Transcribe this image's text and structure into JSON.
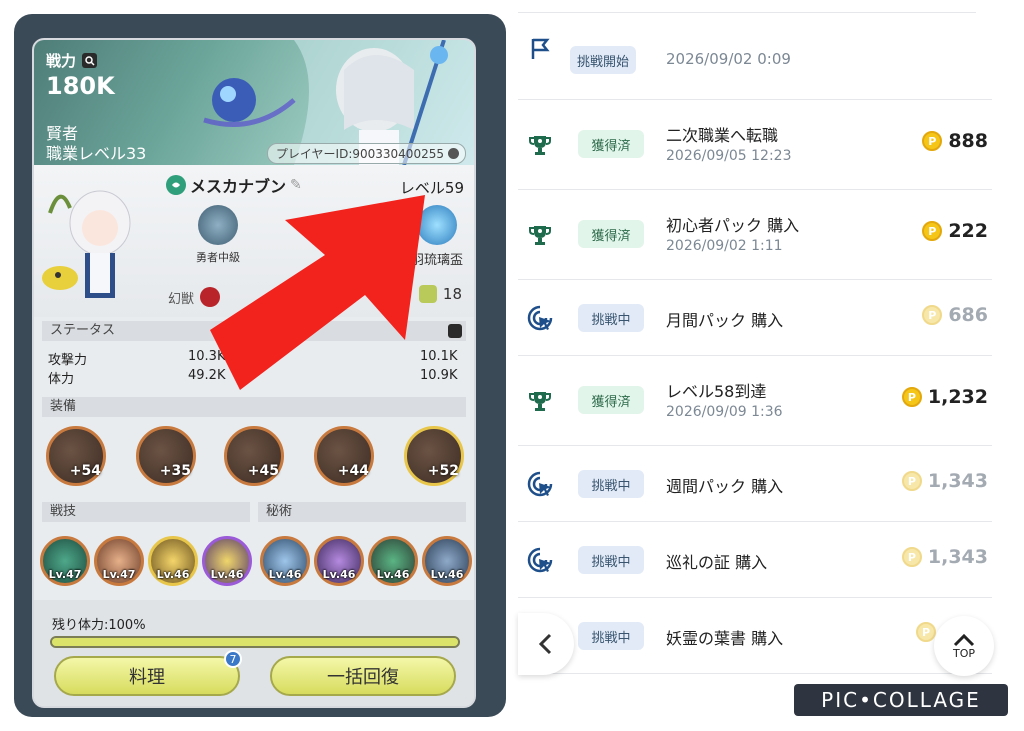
{
  "game": {
    "power_label": "戦力",
    "power_value": "180K",
    "class_name": "賢者",
    "class_level": "職業レベル33",
    "player_id": "プレイヤーID:900330400255",
    "char_name": "メスカナブン",
    "level": "レベル59",
    "badges": [
      {
        "label": "勇者中級"
      },
      {
        "label": "羽琉璃盃"
      }
    ],
    "gen_label": "幻獣",
    "likes": "18",
    "status_header": "ステータス",
    "stats": {
      "atk_label": "攻撃力",
      "atk_value": "10.3K",
      "hp_label": "体力",
      "hp_value": "49.2K",
      "right1": "10.1K",
      "right2": "10.9K"
    },
    "equip_header": "装備",
    "equipment": [
      "+54",
      "+35",
      "+45",
      "+44",
      "+52"
    ],
    "skill_header": "戦技",
    "secret_header": "秘術",
    "skills": [
      "Lv.47",
      "Lv.47",
      "Lv.46",
      "Lv.46",
      "Lv.46",
      "Lv.46",
      "Lv.46",
      "Lv.46"
    ],
    "remaining_hp_label": "残り体力:100%",
    "remaining_hp_fraction": 1.0,
    "cook_button": "料理",
    "cook_badge": "7",
    "recover_button": "一括回復"
  },
  "list": {
    "rows": [
      {
        "icon": "flag-icon",
        "status": "挑戦開始",
        "status_type": "blue",
        "title": "2026/09/02 0:09",
        "date": "",
        "points": ""
      },
      {
        "icon": "trophy-icon",
        "status": "獲得済",
        "status_type": "green",
        "title": "二次職業へ転職",
        "date": "2026/09/05 12:23",
        "points": "888"
      },
      {
        "icon": "trophy-icon",
        "status": "獲得済",
        "status_type": "green",
        "title": "初心者パック 購入",
        "date": "2026/09/02 1:11",
        "points": "222"
      },
      {
        "icon": "cursor-icon",
        "status": "挑戦中",
        "status_type": "blue2",
        "title": "月間パック 購入",
        "date": "",
        "points": "686"
      },
      {
        "icon": "trophy-icon",
        "status": "獲得済",
        "status_type": "green",
        "title": "レベル58到達",
        "date": "2026/09/09 1:36",
        "points": "1,232"
      },
      {
        "icon": "cursor-icon",
        "status": "挑戦中",
        "status_type": "blue2",
        "title": "週間パック 購入",
        "date": "",
        "points": "1,343"
      },
      {
        "icon": "cursor-icon",
        "status": "挑戦中",
        "status_type": "blue2",
        "title": "巡礼の証 購入",
        "date": "",
        "points": "1,343"
      },
      {
        "icon": "cursor-icon",
        "status": "挑戦中",
        "status_type": "blue2",
        "title": "妖霊の葉書 購入",
        "date": "",
        "points": ""
      }
    ],
    "coin_glyph": "P",
    "top_label": "TOP"
  },
  "watermark": "PIC•COLLAGE",
  "colors": {
    "accent_green": "#1f6b4e",
    "accent_blue": "#1e4f8a",
    "coin": "#f5c518"
  }
}
